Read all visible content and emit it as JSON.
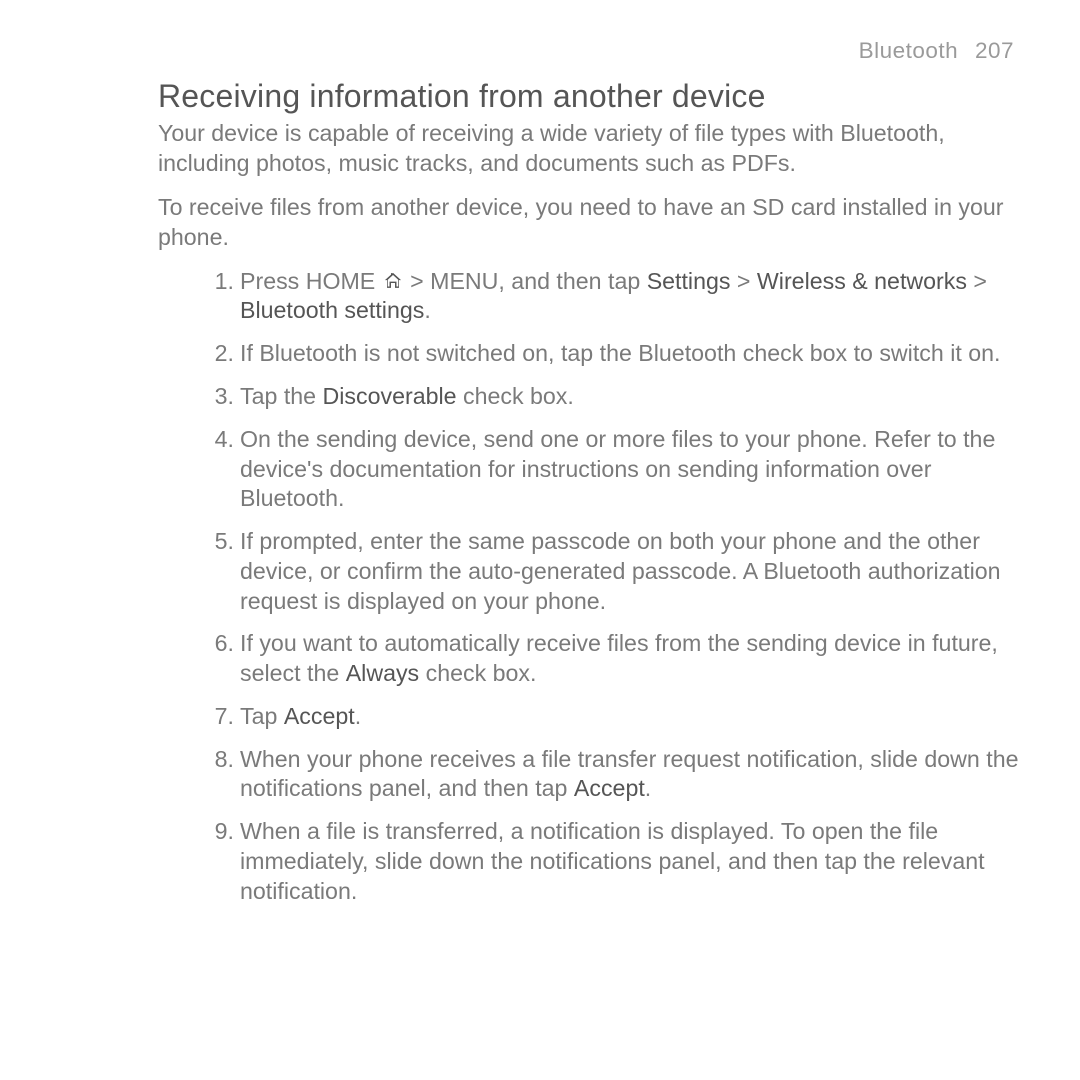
{
  "header": {
    "section": "Bluetooth",
    "page": "207"
  },
  "title": "Receiving information from another device",
  "intro1": "Your device is capable of receiving a wide variety of file types with Bluetooth, including photos, music tracks, and documents such as PDFs.",
  "intro2": "To receive files from another device, you need to have an SD card installed in your phone.",
  "icons": {
    "home": "home-icon"
  },
  "steps": {
    "s1": {
      "pre": "Press HOME ",
      "mid": " > MENU, and then tap ",
      "settings": "Settings",
      "gt1": " > ",
      "wireless": "Wireless & networks",
      "gt2": " > ",
      "bts": "Bluetooth settings",
      "dot": "."
    },
    "s2": "If Bluetooth is not switched on, tap the Bluetooth check box to switch it on.",
    "s3": {
      "pre": "Tap the ",
      "bold": "Discoverable",
      "post": " check box."
    },
    "s4": "On the sending device, send one or more files to your phone. Refer to the device's documentation for instructions on sending information over Bluetooth.",
    "s5": "If prompted, enter the same passcode on both your phone and the other device, or confirm the auto-generated passcode. A Bluetooth authorization request is displayed on your phone.",
    "s6": {
      "pre": "If you want to automatically receive files from the sending device in future, select the ",
      "bold": "Always",
      "post": " check box."
    },
    "s7": {
      "pre": "Tap ",
      "bold": "Accept",
      "post": "."
    },
    "s8": {
      "pre": "When your phone receives a file transfer request notification, slide down the notifications panel, and then tap ",
      "bold": "Accept",
      "post": "."
    },
    "s9": "When a file is transferred, a notification is displayed. To open the file immediately, slide down the notifications panel, and then tap the relevant notification."
  },
  "nums": {
    "n1": "1.",
    "n2": "2.",
    "n3": "3.",
    "n4": "4.",
    "n5": "5.",
    "n6": "6.",
    "n7": "7.",
    "n8": "8.",
    "n9": "9."
  }
}
